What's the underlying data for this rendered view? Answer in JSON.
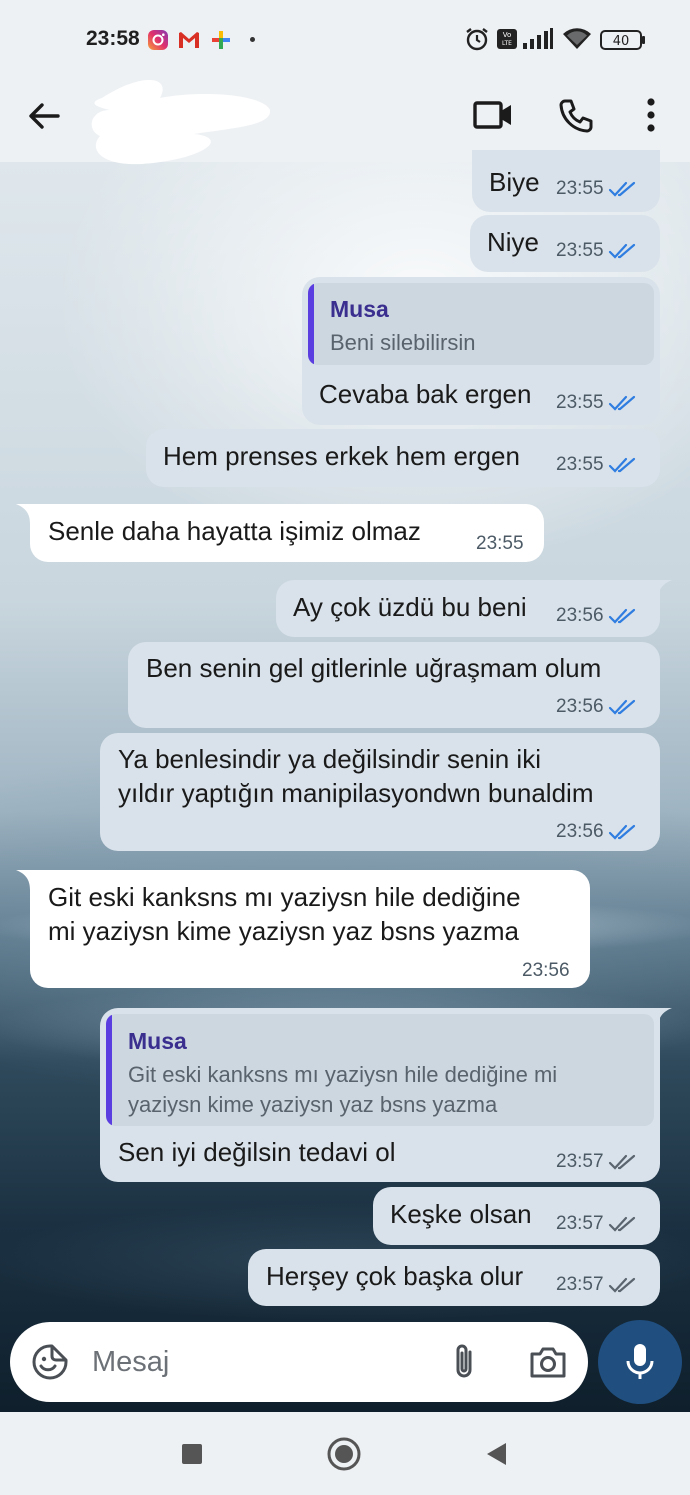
{
  "status_bar": {
    "time": "23:58",
    "battery": "40",
    "left_icons": [
      "instagram-icon",
      "gmail-icon",
      "app-icon"
    ],
    "right_icons": [
      "alarm-icon",
      "volte-icon",
      "signal-icon",
      "wifi-icon",
      "battery-icon"
    ]
  },
  "header": {
    "contact_name": "",
    "icons": [
      "back-arrow-icon",
      "video-call-icon",
      "phone-icon",
      "more-vert-icon"
    ]
  },
  "messages": [
    {
      "dir": "out",
      "text": "Biye",
      "time": "23:55",
      "read": true
    },
    {
      "dir": "out",
      "text": "Niye",
      "time": "23:55",
      "read": true
    },
    {
      "dir": "out",
      "reply_name": "Musa",
      "reply_text": [
        "Beni silebilirsin"
      ],
      "text": "Cevaba bak ergen",
      "time": "23:55",
      "read": true
    },
    {
      "dir": "out",
      "text": "Hem prenses erkek hem ergen",
      "time": "23:55",
      "read": true
    },
    {
      "dir": "in",
      "text": "Senle daha hayatta işimiz olmaz",
      "time": "23:55"
    },
    {
      "dir": "out",
      "text": "Ay çok üzdü bu beni",
      "time": "23:56",
      "read": true
    },
    {
      "dir": "out",
      "text": "Ben senin gel gitlerinle uğraşmam olum",
      "time": "23:56",
      "read": true
    },
    {
      "dir": "out",
      "lines": [
        "Ya benlesindir ya değilsindir senin iki",
        "yıldır yaptığın manipilasyondwn bunaldim"
      ],
      "time": "23:56",
      "read": true
    },
    {
      "dir": "in",
      "lines": [
        "Git eski kanksns mı yaziysn hile dediğine",
        "mi yaziysn kime yaziysn yaz bsns yazma"
      ],
      "time": "23:56"
    },
    {
      "dir": "out",
      "reply_name": "Musa",
      "reply_text": [
        "Git eski kanksns mı yaziysn hile dediğine mi",
        "yaziysn kime yaziysn yaz bsns yazma"
      ],
      "text": "Sen iyi değilsin tedavi ol",
      "time": "23:57",
      "read": false
    },
    {
      "dir": "out",
      "text": "Keşke olsan",
      "time": "23:57",
      "read": false
    },
    {
      "dir": "out",
      "text": "Herşey çok başka olur",
      "time": "23:57",
      "read": false
    }
  ],
  "composer": {
    "placeholder": "Mesaj",
    "value": "",
    "icons": [
      "sticker-icon",
      "attach-icon",
      "camera-icon",
      "mic-icon"
    ]
  },
  "colors": {
    "outgoing_bubble": "#d9e2ea",
    "incoming_bubble": "#ffffff",
    "read_ticks": "#2f7de0",
    "unread_ticks": "#5a6570",
    "reply_bar": "#5b3ee0",
    "mic_button": "#1f4e7f"
  }
}
